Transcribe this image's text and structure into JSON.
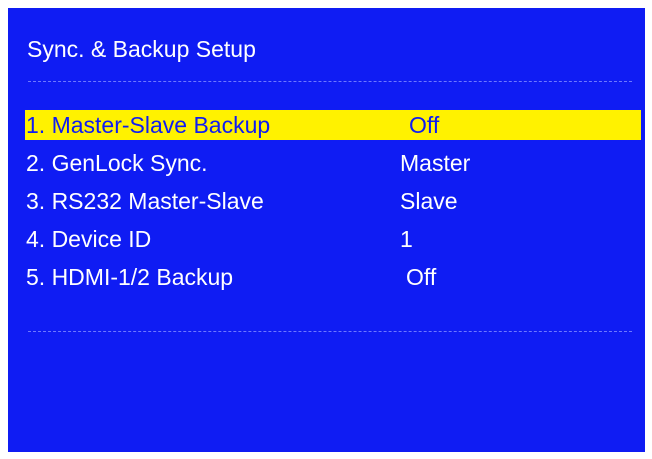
{
  "colors": {
    "background": "#0f1cf3",
    "text": "#ffffff",
    "highlight": "#fff200",
    "highlight_text": "#0f1cf3",
    "divider": "#6d78ff"
  },
  "title": "Sync. & Backup Setup",
  "selected_index": 0,
  "menu": {
    "items": [
      {
        "label": "1. Master-Slave Backup",
        "value": "Off"
      },
      {
        "label": "2. GenLock Sync.",
        "value": "Master"
      },
      {
        "label": "3. RS232 Master-Slave",
        "value": "Slave"
      },
      {
        "label": "4. Device ID",
        "value": "1"
      },
      {
        "label": "5. HDMI-1/2 Backup",
        "value": "Off"
      }
    ]
  }
}
